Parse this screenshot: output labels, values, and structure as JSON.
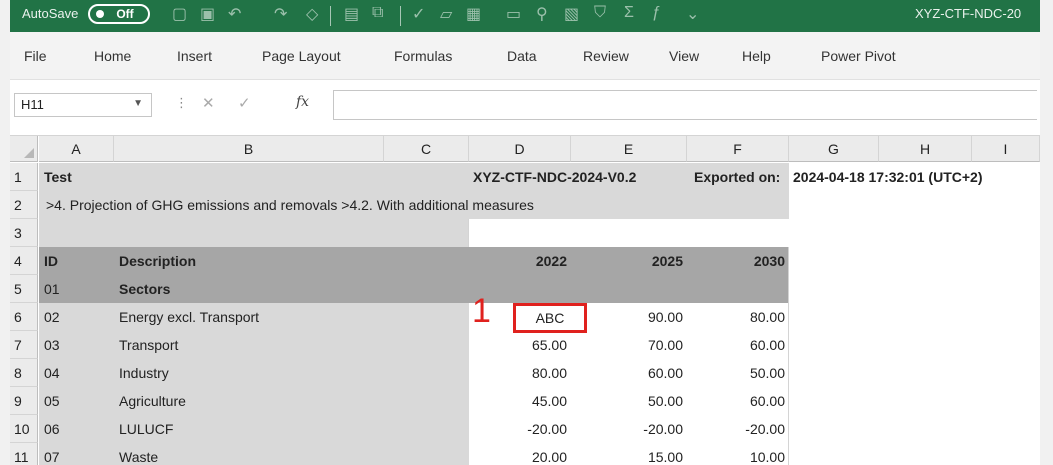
{
  "titlebar": {
    "autosave_label": "AutoSave",
    "autosave_state": "Off",
    "file_title": "XYZ-CTF-NDC-20"
  },
  "menu": [
    "File",
    "Home",
    "Insert",
    "Page Layout",
    "Formulas",
    "Data",
    "Review",
    "View",
    "Help",
    "Power Pivot"
  ],
  "formula_bar": {
    "name_box": "H11",
    "fx": "fx",
    "value": ""
  },
  "columns": [
    "A",
    "B",
    "C",
    "D",
    "E",
    "F",
    "G",
    "H",
    "I"
  ],
  "rows": [
    {
      "num": "1",
      "a": "Test",
      "b": "",
      "d": "XYZ-CTF-NDC-2024-V0.2",
      "e_label": "Exported on:",
      "g": "2024-04-18 17:32:01 (UTC+2)"
    },
    {
      "num": "2",
      "a": ">4. Projection of GHG emissions and removals >4.2. With additional measures"
    },
    {
      "num": "3"
    },
    {
      "num": "4",
      "a": "ID",
      "b": "Description",
      "d": "2022",
      "e": "2025",
      "f": "2030"
    },
    {
      "num": "5",
      "a": "01",
      "b": "Sectors"
    },
    {
      "num": "6",
      "a": "02",
      "b": "Energy excl. Transport",
      "d": "ABC",
      "e": "90.00",
      "f": "80.00"
    },
    {
      "num": "7",
      "a": "03",
      "b": "Transport",
      "d": "65.00",
      "e": "70.00",
      "f": "60.00"
    },
    {
      "num": "8",
      "a": "04",
      "b": "Industry",
      "d": "80.00",
      "e": "60.00",
      "f": "50.00"
    },
    {
      "num": "9",
      "a": "05",
      "b": "Agriculture",
      "d": "45.00",
      "e": "50.00",
      "f": "60.00"
    },
    {
      "num": "10",
      "a": "06",
      "b": "LULUCF",
      "d": "-20.00",
      "e": "-20.00",
      "f": "-20.00"
    },
    {
      "num": "11",
      "a": "07",
      "b": "Waste",
      "d": "20.00",
      "e": "15.00",
      "f": "10.00"
    }
  ],
  "annotation": {
    "number": "1",
    "color": "#e0211e"
  },
  "colors": {
    "excel_green": "#217346",
    "header_shade": "#a6a6a6",
    "data_shade": "#d9d9d9"
  }
}
